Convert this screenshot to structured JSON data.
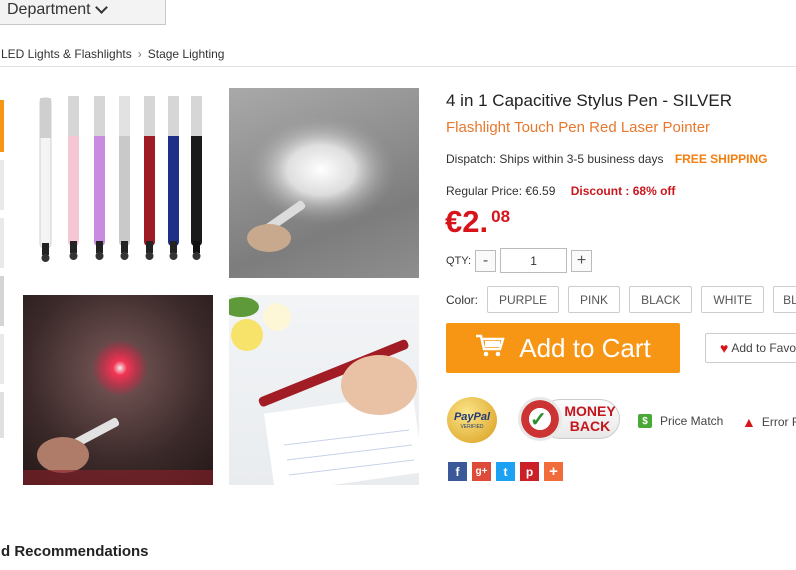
{
  "header": {
    "department_label": "Department"
  },
  "breadcrumb": {
    "items": [
      "LED Lights & Flashlights",
      "Stage Lighting"
    ]
  },
  "product": {
    "title": "4 in 1 Capacitive Stylus Pen -  SILVER",
    "subtitle": "Flashlight Touch Pen Red Laser Pointer"
  },
  "dispatch": {
    "label": "Dispatch:",
    "value": "Ships within 3-5 business days",
    "free_shipping": "FREE SHIPPING"
  },
  "pricing": {
    "regular_label": "Regular Price:",
    "regular_value": "€6.59",
    "discount": "Discount : 68% off",
    "price_main": "€2.",
    "price_cents": "08"
  },
  "quantity": {
    "label": "QTY:",
    "minus": "-",
    "value": "1",
    "plus": "+"
  },
  "color": {
    "label": "Color:",
    "options": [
      "PURPLE",
      "PINK",
      "BLACK",
      "WHITE",
      "BLUE"
    ]
  },
  "actions": {
    "add_to_cart": "Add to Cart",
    "add_to_favorites": "Add to Favorites"
  },
  "badges": {
    "paypal": "PayPal",
    "paypal_sub": "VERIFIED",
    "money_back_1": "MONEY",
    "money_back_2": "BACK"
  },
  "links": {
    "price_match": "Price Match",
    "error_report": "Error Report"
  },
  "social": [
    "f",
    "g+",
    "t",
    "p",
    "+"
  ],
  "social_colors": [
    "#3b5998",
    "#dd4b39",
    "#1da1f2",
    "#cb2027",
    "#f26b3a"
  ],
  "section": {
    "recommendations": "d Recommendations"
  },
  "colors": {
    "accent": "#f79515",
    "price": "#d8141b",
    "subtitle": "#e8782d"
  }
}
